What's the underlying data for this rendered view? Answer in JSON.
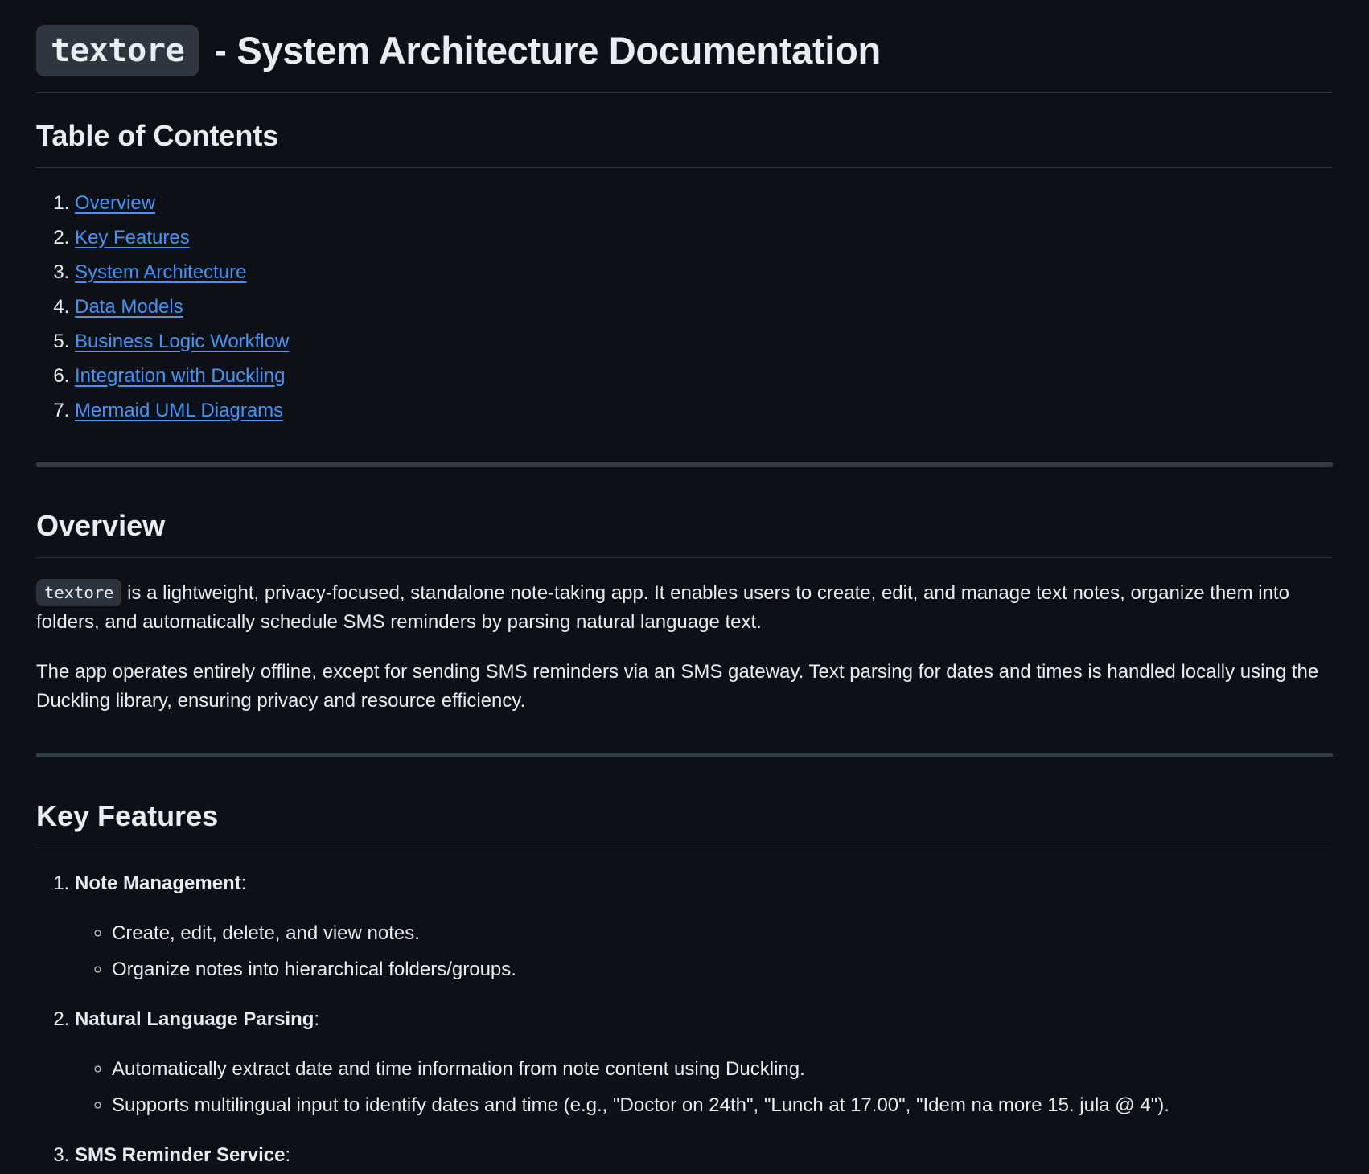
{
  "page": {
    "title_code": "textore",
    "title_rest": " - System Architecture Documentation"
  },
  "toc": {
    "heading": "Table of Contents",
    "items": [
      {
        "label": "Overview"
      },
      {
        "label": "Key Features"
      },
      {
        "label": "System Architecture"
      },
      {
        "label": "Data Models"
      },
      {
        "label": "Business Logic Workflow"
      },
      {
        "label": "Integration with Duckling"
      },
      {
        "label": "Mermaid UML Diagrams"
      }
    ]
  },
  "overview": {
    "heading": "Overview",
    "p1_code": "textore",
    "p1_text": " is a lightweight, privacy-focused, standalone note-taking app. It enables users to create, edit, and manage text notes, organize them into folders, and automatically schedule SMS reminders by parsing natural language text.",
    "p2": "The app operates entirely offline, except for sending SMS reminders via an SMS gateway. Text parsing for dates and times is handled locally using the Duckling library, ensuring privacy and resource efficiency."
  },
  "features": {
    "heading": "Key Features",
    "items": [
      {
        "title": "Note Management",
        "suffix": ":",
        "subitems": [
          "Create, edit, delete, and view notes.",
          "Organize notes into hierarchical folders/groups."
        ]
      },
      {
        "title": "Natural Language Parsing",
        "suffix": ":",
        "subitems": [
          "Automatically extract date and time information from note content using Duckling.",
          "Supports multilingual input to identify dates and time (e.g., \"Doctor on 24th\", \"Lunch at 17.00\", \"Idem na more 15. jula @ 4\")."
        ]
      },
      {
        "title": "SMS Reminder Service",
        "suffix": ":",
        "subitems": []
      }
    ]
  }
}
